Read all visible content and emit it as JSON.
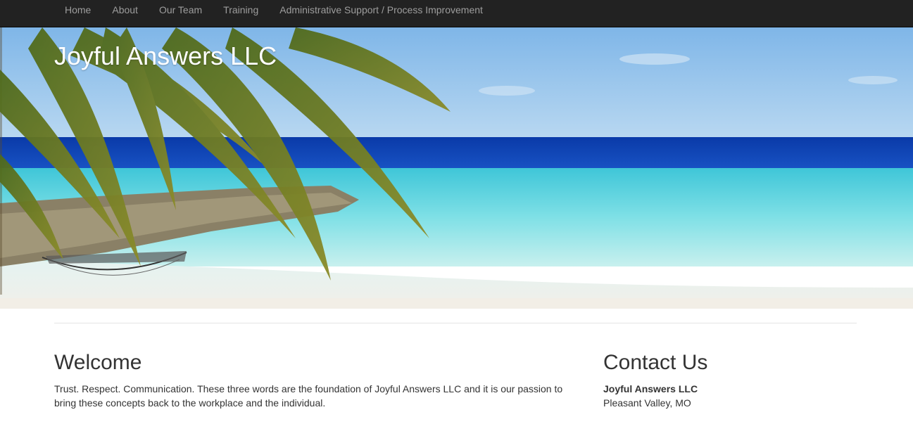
{
  "nav": {
    "items": [
      {
        "label": "Home"
      },
      {
        "label": "About"
      },
      {
        "label": "Our Team"
      },
      {
        "label": "Training"
      },
      {
        "label": "Administrative Support / Process Improvement"
      }
    ]
  },
  "hero": {
    "title": "Joyful Answers LLC"
  },
  "welcome": {
    "heading": "Welcome",
    "text": "Trust. Respect. Communication. These three words are the foundation of Joyful Answers LLC and it is our passion to bring these concepts back to the workplace and the individual."
  },
  "contact": {
    "heading": "Contact Us",
    "name": "Joyful Answers LLC",
    "location": "Pleasant Valley, MO"
  },
  "colors": {
    "navbar_bg": "#222222",
    "nav_text": "#9d9d9d",
    "text": "#333333"
  }
}
